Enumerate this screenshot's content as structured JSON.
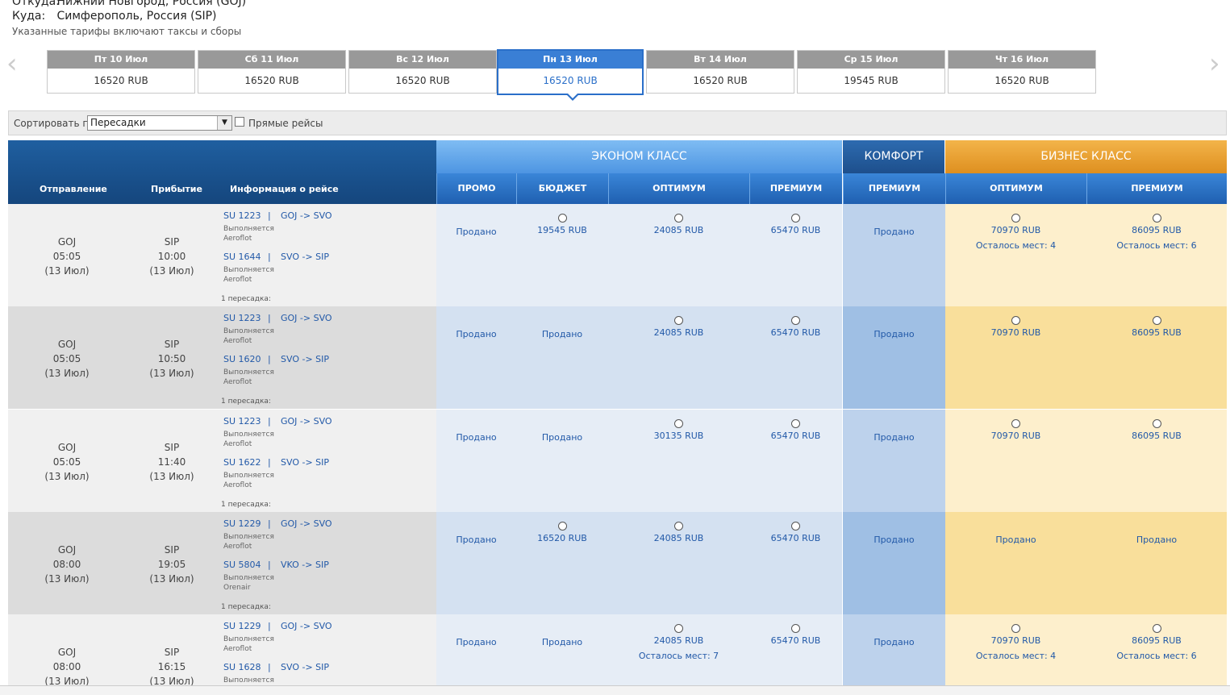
{
  "route": {
    "from_label": "Откуда:",
    "from_value": "Нижний Новгород, Россия (GOJ)",
    "to_label": "Куда:",
    "to_value": "Симферополь, Россия (SIP)",
    "note": "Указанные тарифы включают таксы и сборы"
  },
  "date_nav": {
    "prev_icon": "chevron-left-icon",
    "next_icon": "chevron-right-icon",
    "dates": [
      {
        "label": "Пт 10 Июл",
        "price": "16520 RUB"
      },
      {
        "label": "Сб 11 Июл",
        "price": "16520 RUB"
      },
      {
        "label": "Вс 12 Июл",
        "price": "16520 RUB"
      },
      {
        "label": "Пн 13 Июл",
        "price": "16520 RUB",
        "selected": true
      },
      {
        "label": "Вт 14 Июл",
        "price": "16520 RUB"
      },
      {
        "label": "Ср 15 Июл",
        "price": "19545 RUB"
      },
      {
        "label": "Чт 16 Июл",
        "price": "16520 RUB"
      }
    ]
  },
  "sort": {
    "label": "Сортировать по",
    "selected": "Пересадки",
    "direct_label": "Прямые рейсы",
    "direct_checked": false
  },
  "table": {
    "columns": {
      "departure": "Отправление",
      "arrival": "Прибытие",
      "flight_info": "Информация о рейсе"
    },
    "groups": {
      "economy": "ЭКОНОМ КЛАСС",
      "comfort": "КОМФОРТ",
      "business": "БИЗНЕС КЛАСС"
    },
    "fare_types": [
      "ПРОМО",
      "БЮДЖЕТ",
      "ОПТИМУМ",
      "ПРЕМИУМ",
      "ПРЕМИУМ",
      "ОПТИМУМ",
      "ПРЕМИУМ"
    ],
    "rows": [
      {
        "dep_code": "GOJ",
        "dep_time": "05:05",
        "dep_date": "(13 Июл)",
        "arr_code": "SIP",
        "arr_time": "10:00",
        "arr_date": "(13 Июл)",
        "segments": [
          {
            "flight": "SU 1223",
            "sep": "|",
            "route": "GOJ -> SVO",
            "status": "Выполняется",
            "carrier": "Aeroflot"
          },
          {
            "flight": "SU 1644",
            "sep": "|",
            "route": "SVO -> SIP",
            "status": "Выполняется",
            "carrier": "Aeroflot"
          }
        ],
        "transfers": "1 пересадка:",
        "fares": [
          {
            "text": "Продано",
            "radio": false,
            "seats": ""
          },
          {
            "text": "19545 RUB",
            "radio": true,
            "seats": ""
          },
          {
            "text": "24085 RUB",
            "radio": true,
            "seats": ""
          },
          {
            "text": "65470 RUB",
            "radio": true,
            "seats": ""
          },
          {
            "text": "Продано",
            "radio": false,
            "seats": ""
          },
          {
            "text": "70970 RUB",
            "radio": true,
            "seats": "Осталось мест: 4"
          },
          {
            "text": "86095 RUB",
            "radio": true,
            "seats": "Осталось мест: 6"
          }
        ]
      },
      {
        "dep_code": "GOJ",
        "dep_time": "05:05",
        "dep_date": "(13 Июл)",
        "arr_code": "SIP",
        "arr_time": "10:50",
        "arr_date": "(13 Июл)",
        "segments": [
          {
            "flight": "SU 1223",
            "sep": "|",
            "route": "GOJ -> SVO",
            "status": "Выполняется",
            "carrier": "Aeroflot"
          },
          {
            "flight": "SU 1620",
            "sep": "|",
            "route": "SVO -> SIP",
            "status": "Выполняется",
            "carrier": "Aeroflot"
          }
        ],
        "transfers": "1 пересадка:",
        "fares": [
          {
            "text": "Продано",
            "radio": false,
            "seats": ""
          },
          {
            "text": "Продано",
            "radio": false,
            "seats": ""
          },
          {
            "text": "24085 RUB",
            "radio": true,
            "seats": ""
          },
          {
            "text": "65470 RUB",
            "radio": true,
            "seats": ""
          },
          {
            "text": "Продано",
            "radio": false,
            "seats": ""
          },
          {
            "text": "70970 RUB",
            "radio": true,
            "seats": ""
          },
          {
            "text": "86095 RUB",
            "radio": true,
            "seats": ""
          }
        ]
      },
      {
        "dep_code": "GOJ",
        "dep_time": "05:05",
        "dep_date": "(13 Июл)",
        "arr_code": "SIP",
        "arr_time": "11:40",
        "arr_date": "(13 Июл)",
        "segments": [
          {
            "flight": "SU 1223",
            "sep": "|",
            "route": "GOJ -> SVO",
            "status": "Выполняется",
            "carrier": "Aeroflot"
          },
          {
            "flight": "SU 1622",
            "sep": "|",
            "route": "SVO -> SIP",
            "status": "Выполняется",
            "carrier": "Aeroflot"
          }
        ],
        "transfers": "1 пересадка:",
        "fares": [
          {
            "text": "Продано",
            "radio": false,
            "seats": ""
          },
          {
            "text": "Продано",
            "radio": false,
            "seats": ""
          },
          {
            "text": "30135 RUB",
            "radio": true,
            "seats": ""
          },
          {
            "text": "65470 RUB",
            "radio": true,
            "seats": ""
          },
          {
            "text": "Продано",
            "radio": false,
            "seats": ""
          },
          {
            "text": "70970 RUB",
            "radio": true,
            "seats": ""
          },
          {
            "text": "86095 RUB",
            "radio": true,
            "seats": ""
          }
        ]
      },
      {
        "dep_code": "GOJ",
        "dep_time": "08:00",
        "dep_date": "(13 Июл)",
        "arr_code": "SIP",
        "arr_time": "19:05",
        "arr_date": "(13 Июл)",
        "segments": [
          {
            "flight": "SU 1229",
            "sep": "|",
            "route": "GOJ -> SVO",
            "status": "Выполняется",
            "carrier": "Aeroflot"
          },
          {
            "flight": "SU 5804",
            "sep": "|",
            "route": "VKO -> SIP",
            "status": "Выполняется",
            "carrier": "Orenair"
          }
        ],
        "transfers": "1 пересадка:",
        "fares": [
          {
            "text": "Продано",
            "radio": false,
            "seats": ""
          },
          {
            "text": "16520 RUB",
            "radio": true,
            "seats": ""
          },
          {
            "text": "24085 RUB",
            "radio": true,
            "seats": ""
          },
          {
            "text": "65470 RUB",
            "radio": true,
            "seats": ""
          },
          {
            "text": "Продано",
            "radio": false,
            "seats": ""
          },
          {
            "text": "Продано",
            "radio": false,
            "seats": ""
          },
          {
            "text": "Продано",
            "radio": false,
            "seats": ""
          }
        ]
      },
      {
        "dep_code": "GOJ",
        "dep_time": "08:00",
        "dep_date": "(13 Июл)",
        "arr_code": "SIP",
        "arr_time": "16:15",
        "arr_date": "(13 Июл)",
        "segments": [
          {
            "flight": "SU 1229",
            "sep": "|",
            "route": "GOJ -> SVO",
            "status": "Выполняется",
            "carrier": "Aeroflot"
          },
          {
            "flight": "SU 1628",
            "sep": "|",
            "route": "SVO -> SIP",
            "status": "Выполняется",
            "carrier": ""
          }
        ],
        "transfers": "",
        "fares": [
          {
            "text": "Продано",
            "radio": false,
            "seats": ""
          },
          {
            "text": "Продано",
            "radio": false,
            "seats": ""
          },
          {
            "text": "24085 RUB",
            "radio": true,
            "seats": "Осталось мест: 7"
          },
          {
            "text": "65470 RUB",
            "radio": true,
            "seats": ""
          },
          {
            "text": "Продано",
            "radio": false,
            "seats": ""
          },
          {
            "text": "70970 RUB",
            "radio": true,
            "seats": "Осталось мест: 4"
          },
          {
            "text": "86095 RUB",
            "radio": true,
            "seats": "Осталось мест: 6"
          }
        ]
      }
    ]
  }
}
